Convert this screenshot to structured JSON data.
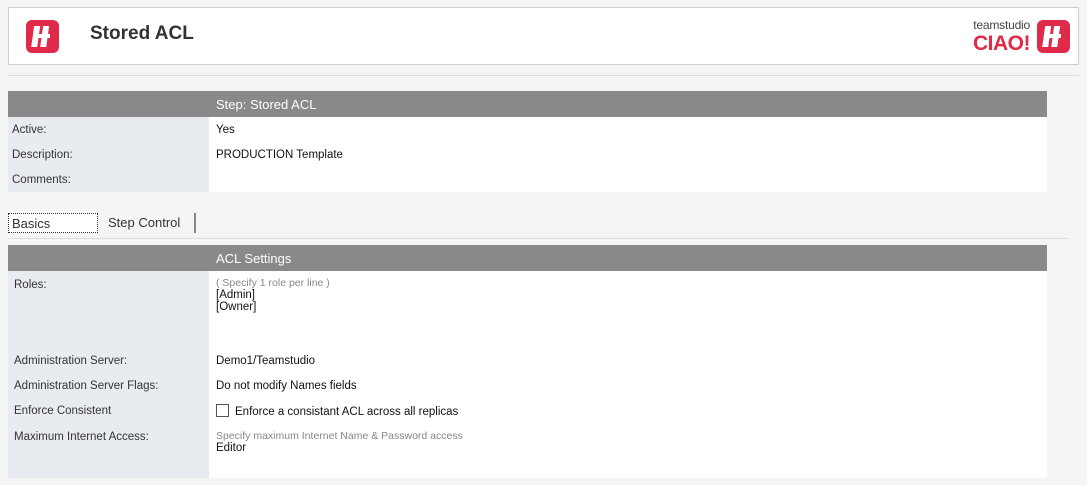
{
  "header": {
    "title": "Stored ACL",
    "brand_small": "teamstudio",
    "brand_big": "CIAO!"
  },
  "step_section": {
    "heading": "Step:  Stored ACL",
    "rows": [
      {
        "label": "Active:",
        "value": "Yes"
      },
      {
        "label": "Description:",
        "value": "PRODUCTION Template"
      },
      {
        "label": "Comments:",
        "value": ""
      }
    ]
  },
  "tabs": [
    {
      "label": "Basics",
      "active": true
    },
    {
      "label": "Step Control",
      "active": false
    }
  ],
  "acl_section": {
    "heading": "ACL Settings",
    "roles_label": "Roles:",
    "roles_hint": "( Specify 1 role per line )",
    "roles": [
      "[Admin]",
      "[Owner]"
    ],
    "admin_server_label": "Administration Server:",
    "admin_server_value": "Demo1/Teamstudio",
    "admin_flags_label": "Administration Server Flags:",
    "admin_flags_value": "Do not modify Names fields",
    "enforce_label": "Enforce Consistent",
    "enforce_checkbox_label": "Enforce a consistant ACL across all replicas",
    "enforce_checked": false,
    "max_access_label": "Maximum Internet Access:",
    "max_access_hint": "Specify maximum Internet Name & Password access",
    "max_access_value": "Editor"
  },
  "colors": {
    "brand_red": "#e02a4a",
    "section_header": "#898989",
    "label_bg": "#e8ecf1"
  }
}
